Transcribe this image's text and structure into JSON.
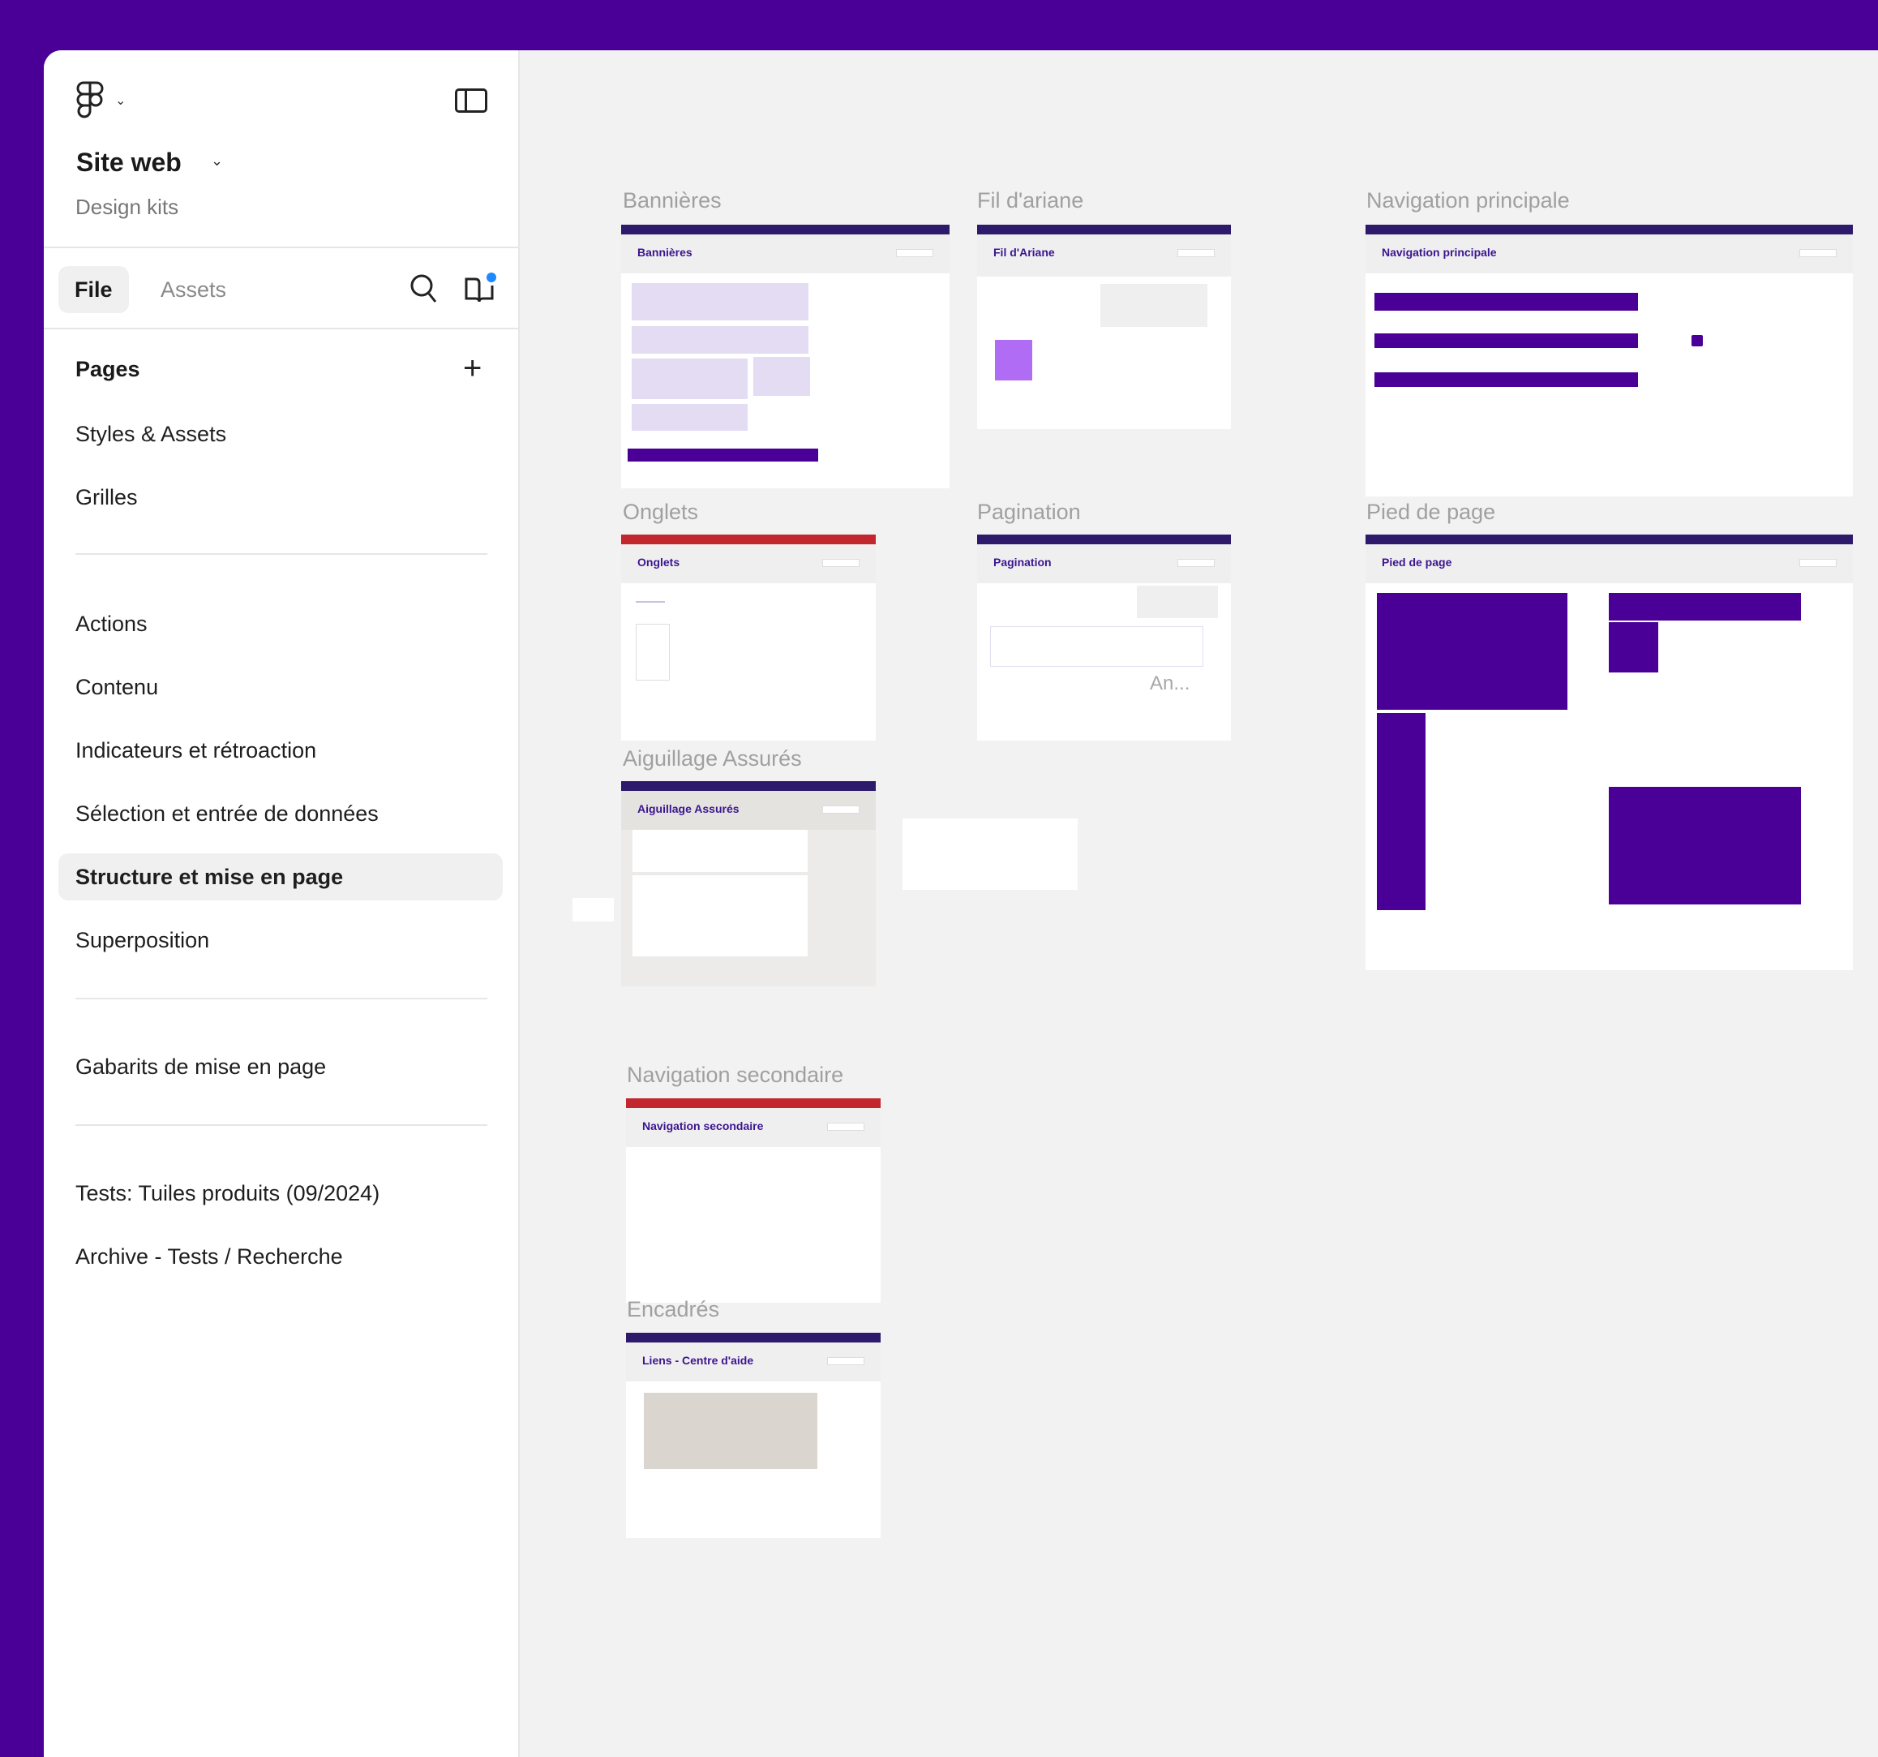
{
  "app": {
    "project_title": "Site web",
    "project_subtitle": "Design kits",
    "colors": {
      "brand": "#4a0096",
      "canvas": "#f2f2f2",
      "notification_dot": "#1e88ff"
    }
  },
  "sidebar": {
    "tabs": [
      {
        "label": "File",
        "active": true
      },
      {
        "label": "Assets",
        "active": false
      }
    ],
    "icons": {
      "search": "search-icon",
      "library": "library-icon",
      "panel": "panel-toggle-icon",
      "menu": "figma-logo-icon"
    },
    "pages_title": "Pages",
    "pages": [
      {
        "label": "Styles & Assets"
      },
      {
        "label": "Grilles"
      },
      {
        "label": "Actions"
      },
      {
        "label": "Contenu"
      },
      {
        "label": "Indicateurs et rétroaction"
      },
      {
        "label": "Sélection et entrée de données"
      },
      {
        "label": "Structure et mise en page",
        "selected": true
      },
      {
        "label": "Superposition"
      },
      {
        "label": "Gabarits de mise en page"
      },
      {
        "label": "Tests: Tuiles produits (09/2024)"
      },
      {
        "label": "Archive - Tests / Recherche"
      }
    ]
  },
  "canvas": {
    "frames": [
      {
        "label": "Bannières",
        "title": "Bannières"
      },
      {
        "label": "Fil d'ariane",
        "title": "Fil d'Ariane"
      },
      {
        "label": "Navigation principale",
        "title": "Navigation principale"
      },
      {
        "label": "Onglets",
        "title": "Onglets"
      },
      {
        "label": "Pagination",
        "title": "Pagination",
        "inner_label": "An..."
      },
      {
        "label": "Pied de page",
        "title": "Pied de page"
      },
      {
        "label": "Aiguillage Assurés",
        "title": "Aiguillage Assurés"
      },
      {
        "label": "Navigation secondaire",
        "title": "Navigation secondaire"
      },
      {
        "label": "Encadrés",
        "title": "Liens - Centre d'aide"
      }
    ]
  }
}
